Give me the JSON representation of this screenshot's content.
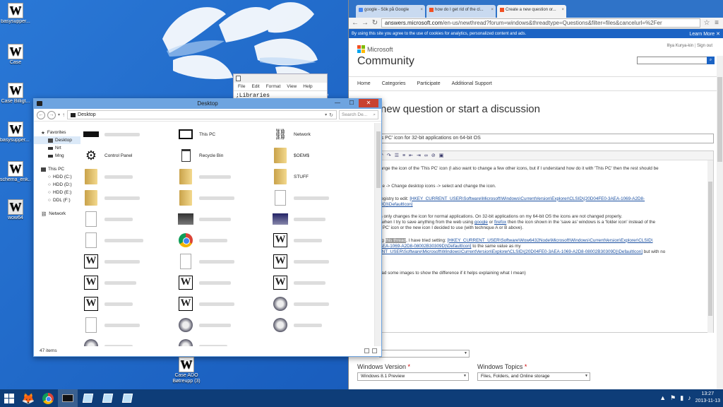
{
  "desktop": {
    "icons": [
      {
        "label": "basysupper...",
        "icon": "word-doc-icon"
      },
      {
        "label": "Case",
        "icon": "word-doc-icon"
      },
      {
        "label": "Case Billigt...",
        "icon": "word-doc-icon"
      },
      {
        "label": "basysupper... (3)",
        "icon": "word-doc-icon"
      },
      {
        "label": "schema_enk...",
        "icon": "word-doc-icon"
      },
      {
        "label": "wow64",
        "icon": "word-doc-icon"
      }
    ],
    "bottom_icon": {
      "label": "Case ADO Bøtreupp (3)",
      "icon": "word-doc-icon"
    }
  },
  "notepad": {
    "menu": [
      "File",
      "Edit",
      "Format",
      "View",
      "Help"
    ],
    "content": ";Libraries"
  },
  "explorer": {
    "title": "Desktop",
    "path": "Desktop",
    "search_placeholder": "Search De...",
    "nav": {
      "favorites": "Favorites",
      "favorites_items": [
        "Desktop",
        "Nrt",
        "Mng"
      ],
      "thispc": "This PC",
      "drives": [
        "HDD (C:)",
        "HDD (D:)",
        "HDD (E:)",
        "DDL (F:)"
      ],
      "network": "Network"
    },
    "items": {
      "thispc": "This PC",
      "network": "Network",
      "control_panel": "Control Panel",
      "recycle_bin": "Recycle Bin",
      "oems": "$OEM$",
      "stuff": "STUFF"
    },
    "status": "47 items"
  },
  "browser": {
    "tabs": [
      {
        "title": "google - Sök på Google"
      },
      {
        "title": "how do I get rid of the cl..."
      },
      {
        "title": "Create a new question or..."
      }
    ],
    "url_prefix": "answers.microsoft.com",
    "url_rest": "/en-us/newthread?forum=windows&threadtype=Questions&filter=files&cancelurl=%2Fer",
    "cookie_text": "By using this site you agree to the use of cookies for analytics, personalized content and ads.",
    "cookie_more": "Learn More",
    "brand": "Microsoft",
    "site_title": "Community",
    "user_name": "Illya Kurya-kin",
    "sign_out": "Sign out",
    "menu": [
      "Home",
      "Categories",
      "Participate",
      "Additional Support"
    ],
    "heading": "e a new question or start a discussion",
    "title_value": "This PC' icon for 32-bit applications on 64-bit OS",
    "editor": {
      "p1": "change the icon of the 'This PC' icon (I also want to change a few other icons, but if I understand how do it with 'This PC' then the rest should be",
      "p2a": "d:",
      "p2b": "alize -> Change desktop icons -> select and change the icon.",
      "p3a": "e registry to edit:",
      "p3link": "[HKEY_CURRENT_USER\\Software\\Microsoft\\Windows\\CurrentVersion\\Explorer\\CLSID\\{20D04FE0-3AEA-1069-A2D8-",
      "p3link2": "309D}\\DefaultIcon]",
      "p4": "this only changes the icon for normal applications. On 32-bit applications on my 64-bit OS the icons are not changed properly.",
      "p4b": "ce when I try to save anything from the web using",
      "p4g": "google",
      "p4or": "or",
      "p4f": "firefox",
      "p4c": "then the icon shown in the 'save as' windows is a 'folder icon' instead of the",
      "p4d": "his PC' icon or the new icon I decided to use (with technique A or B above).",
      "p5a": "ding",
      "p5hl": "this thread",
      "p5b": ", I have tried setting:",
      "p5link": "[HKEY_CURRENT_USER\\Software\\Wow6432Node\\Microsoft\\Windows\\CurrentVersion\\Explorer\\CLSID\\",
      "p5link2": "-3AEA-1069-A2D8-08002B30309D}\\DefaultIcon]",
      "p5c": "to the same value as my",
      "p5d": "RENT_USER\\Software\\Microsoft\\Windows\\CurrentVersion\\Explorer\\CLSID\\{20D04FE0-3AEA-1069-A2D8-08002B30309D}\\DefaultIcon]",
      "p5e": "but with no",
      "p6": "pload some images to show the difference if it helps explaining what I mean)"
    },
    "windows_version_label": "Windows Version",
    "windows_version_value": "Windows 8.1 Preview",
    "windows_topics_label": "Windows Topics",
    "windows_topics_value": "Files, Folders, and Online storage",
    "required": "*"
  },
  "taskbar": {
    "time": "13:27",
    "date": "2013-11-13"
  },
  "colors": {
    "accent": "#1b63c4",
    "explorer_frame": "#6ea4e0",
    "taskbar": "#0e3d78"
  }
}
